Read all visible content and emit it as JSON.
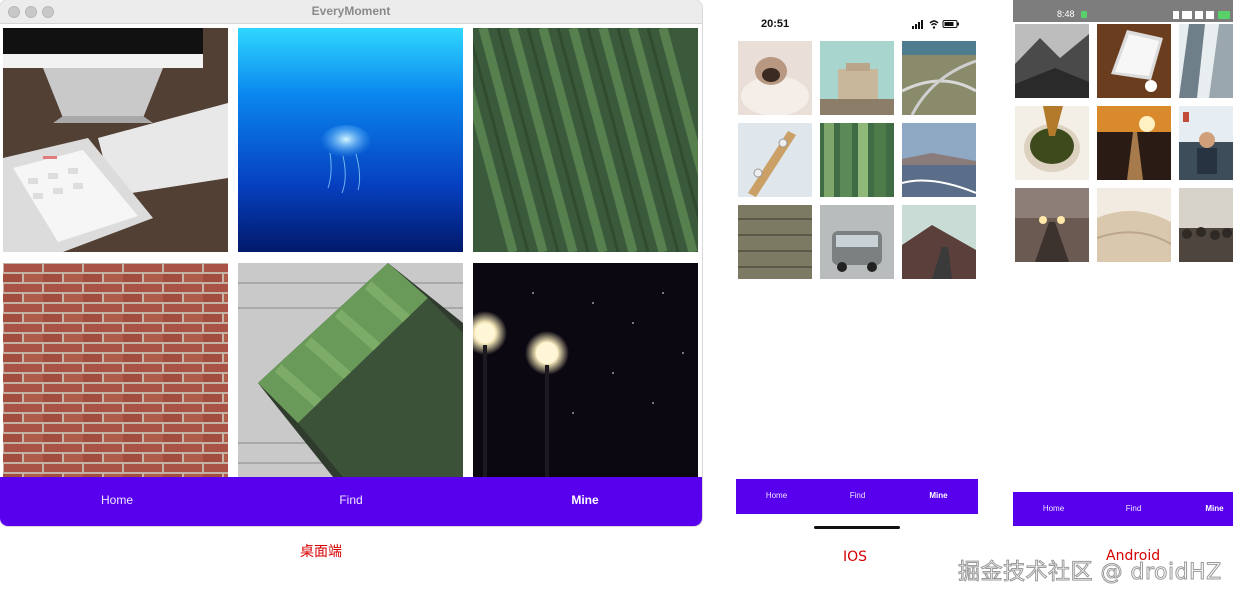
{
  "desktop": {
    "window_title": "EveryMoment",
    "nav": {
      "home": "Home",
      "find": "Find",
      "mine": "Mine"
    },
    "caption": "桌面端",
    "photos": [
      "desk-with-imac-keyboard-tablet",
      "jellyfish-underwater",
      "tea-field-rows",
      "red-brick-wall",
      "soccer-field-aerial",
      "street-lamps-at-night"
    ]
  },
  "ios": {
    "time": "20:51",
    "nav": {
      "home": "Home",
      "find": "Find",
      "mine": "Mine"
    },
    "caption": "IOS",
    "photos": [
      "pug-in-blanket",
      "old-building",
      "highway-interchange",
      "skateboard",
      "bamboo",
      "golden-gate-bridge",
      "wooden-planks",
      "vintage-van",
      "mountain-road"
    ]
  },
  "android": {
    "time": "8:48",
    "nav": {
      "home": "Home",
      "find": "Find",
      "mine": "Mine"
    },
    "caption": "Android",
    "photos": [
      "mountains-bw",
      "laptop-on-desk",
      "skyscrapers",
      "green-tea-cup",
      "railway-sunset",
      "cafe-window",
      "foggy-road-lights",
      "desert-dunes",
      "crowd"
    ]
  },
  "watermark": "掘金技术社区 @ droidHZ",
  "colors": {
    "nav_purple": "#5800ee",
    "caption_red": "#d60000"
  }
}
